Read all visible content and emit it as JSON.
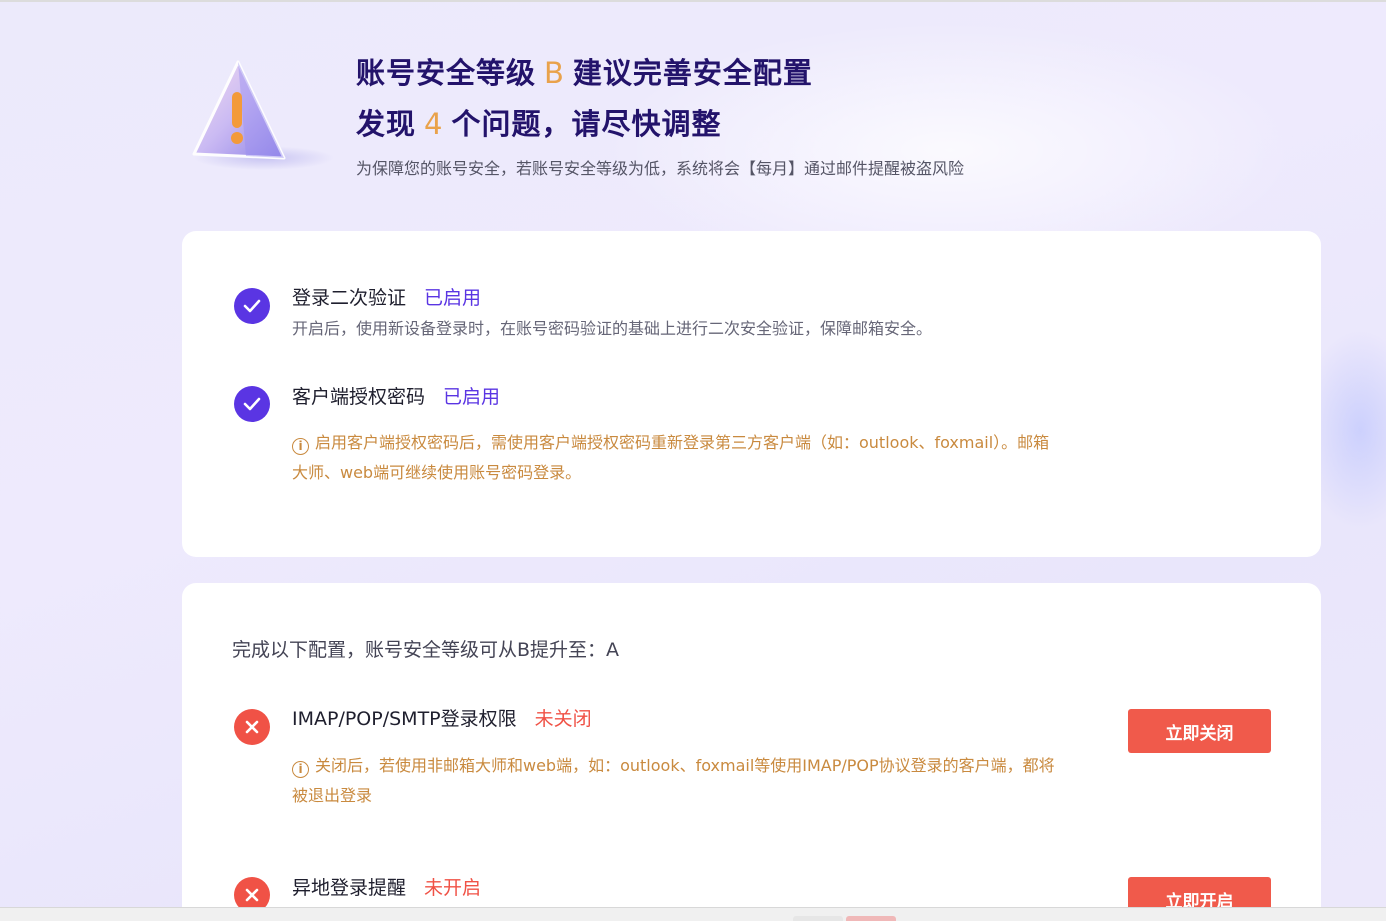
{
  "header": {
    "title_prefix": "账号安全等级",
    "level": "B",
    "title_suffix": "建议完善安全配置",
    "issues_prefix": "发现",
    "issues_count": "4",
    "issues_suffix": "个问题，请尽快调整",
    "subtitle": "为保障您的账号安全，若账号安全等级为低，系统将会【每月】通过邮件提醒被盗风险",
    "icon": "warning-triangle-icon"
  },
  "enabled_section": {
    "items": [
      {
        "title": "登录二次验证",
        "status": "已启用",
        "desc": "开启后，使用新设备登录时，在账号密码验证的基础上进行二次安全验证，保障邮箱安全。",
        "icon": "check-circle-icon"
      },
      {
        "title": "客户端授权密码",
        "status": "已启用",
        "note_line1": "启用客户端授权密码后，需使用客户端授权密码重新登录第三方客户端（如：outlook、foxmail）。邮箱",
        "note_line2": "大师、web端可继续使用账号密码登录。",
        "icon": "check-circle-icon"
      }
    ]
  },
  "todo_section": {
    "hint": "完成以下配置，账号安全等级可从B提升至：A",
    "items": [
      {
        "title": "IMAP/POP/SMTP登录权限",
        "status": "未关闭",
        "note_line1": "关闭后，若使用非邮箱大师和web端，如：outlook、foxmail等使用IMAP/POP协议登录的客户端，都将",
        "note_line2": "被退出登录",
        "button": "立即关闭",
        "icon": "x-circle-icon"
      },
      {
        "title": "异地登录提醒",
        "status": "未开启",
        "button": "立即开启",
        "icon": "x-circle-icon"
      }
    ]
  },
  "colors": {
    "primary": "#5a35e3",
    "danger": "#f05246",
    "accent": "#e9a24b",
    "note": "#c98a3f",
    "title": "#23136b"
  }
}
